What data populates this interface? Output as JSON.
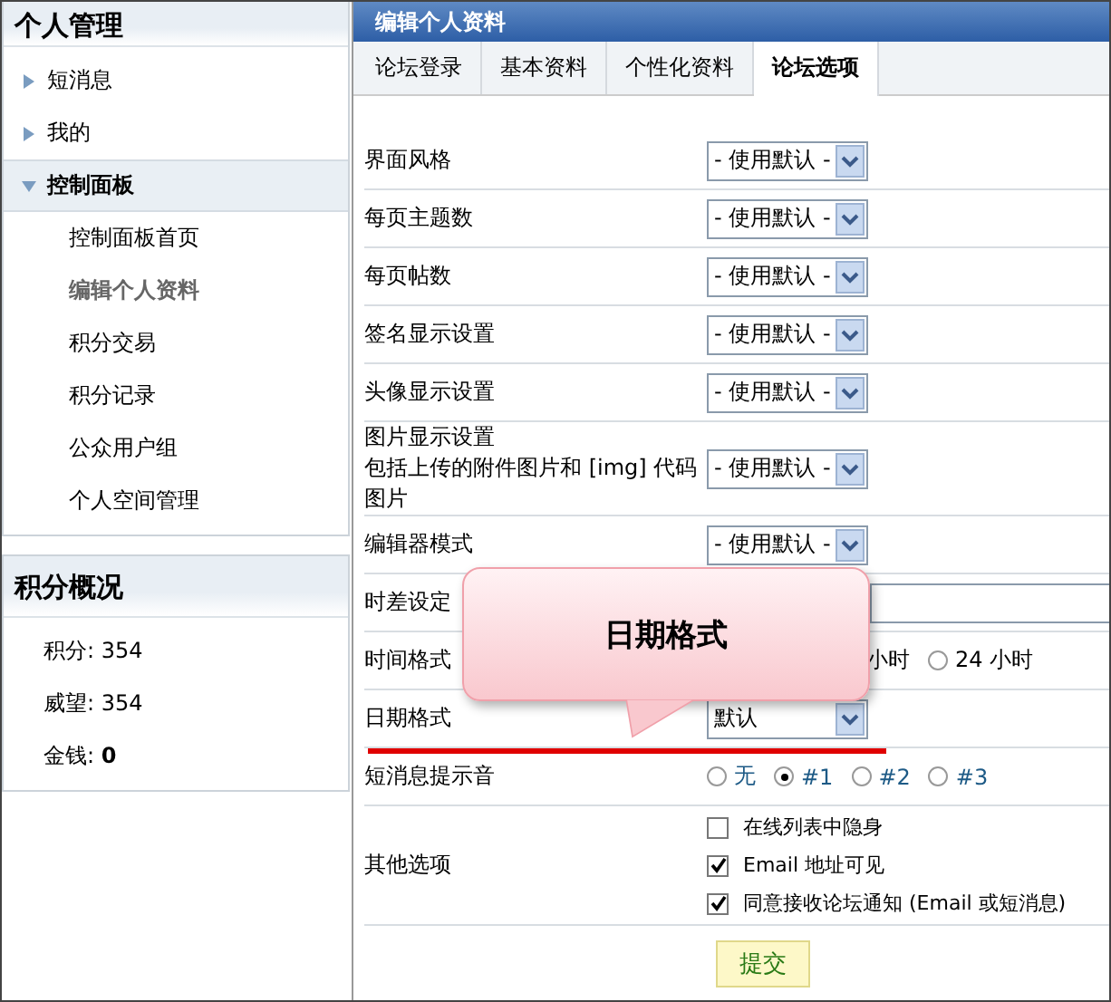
{
  "sidebar": {
    "title": "个人管理",
    "items": [
      {
        "label": "短消息",
        "expanded": false
      },
      {
        "label": "我的",
        "expanded": false
      },
      {
        "label": "控制面板",
        "expanded": true,
        "children": [
          {
            "label": "控制面板首页",
            "selected": false
          },
          {
            "label": "编辑个人资料",
            "selected": true
          },
          {
            "label": "积分交易",
            "selected": false
          },
          {
            "label": "积分记录",
            "selected": false
          },
          {
            "label": "公众用户组",
            "selected": false
          },
          {
            "label": "个人空间管理",
            "selected": false
          }
        ]
      }
    ]
  },
  "credits": {
    "title": "积分概况",
    "items": [
      {
        "label": "积分:",
        "value": "354",
        "bold": false
      },
      {
        "label": "威望:",
        "value": "354",
        "bold": false
      },
      {
        "label": "金钱:",
        "value": "0",
        "bold": true
      }
    ]
  },
  "panel": {
    "title": "编辑个人资料",
    "tabs": [
      {
        "label": "论坛登录",
        "selected": false
      },
      {
        "label": "基本资料",
        "selected": false
      },
      {
        "label": "个性化资料",
        "selected": false
      },
      {
        "label": "论坛选项",
        "selected": true
      }
    ]
  },
  "rows": [
    {
      "kind": "select",
      "label": "界面风格",
      "value": "- 使用默认 -"
    },
    {
      "kind": "select",
      "label": "每页主题数",
      "value": "- 使用默认 -"
    },
    {
      "kind": "select",
      "label": "每页帖数",
      "value": "- 使用默认 -"
    },
    {
      "kind": "select",
      "label": "签名显示设置",
      "value": "- 使用默认 -"
    },
    {
      "kind": "select",
      "label": "头像显示设置",
      "value": "- 使用默认 -"
    },
    {
      "kind": "select",
      "label": "图片显示设置",
      "note": "包括上传的附件图片和 [img] 代码图片",
      "value": "- 使用默认 -"
    },
    {
      "kind": "select",
      "label": "编辑器模式",
      "value": "- 使用默认 -"
    },
    {
      "kind": "field",
      "label": "时差设定"
    },
    {
      "kind": "radio",
      "label": "时间格式",
      "fragment": "小时",
      "options": [
        {
          "label": "24 小时",
          "selected": false
        }
      ]
    },
    {
      "kind": "select",
      "label": "日期格式",
      "value": "默认"
    },
    {
      "kind": "radio",
      "label": "短消息提示音",
      "options": [
        {
          "label": "无",
          "selected": false
        },
        {
          "label": "#1",
          "selected": true
        },
        {
          "label": "#2",
          "selected": false
        },
        {
          "label": "#3",
          "selected": false
        }
      ]
    },
    {
      "kind": "checks",
      "label": "其他选项",
      "options": [
        {
          "label": "在线列表中隐身",
          "checked": false
        },
        {
          "label": "Email 地址可见",
          "checked": true
        },
        {
          "label": "同意接收论坛通知 (Email 或短消息)",
          "checked": true
        }
      ]
    }
  ],
  "submit": "提交",
  "callout": {
    "text": "日期格式"
  }
}
